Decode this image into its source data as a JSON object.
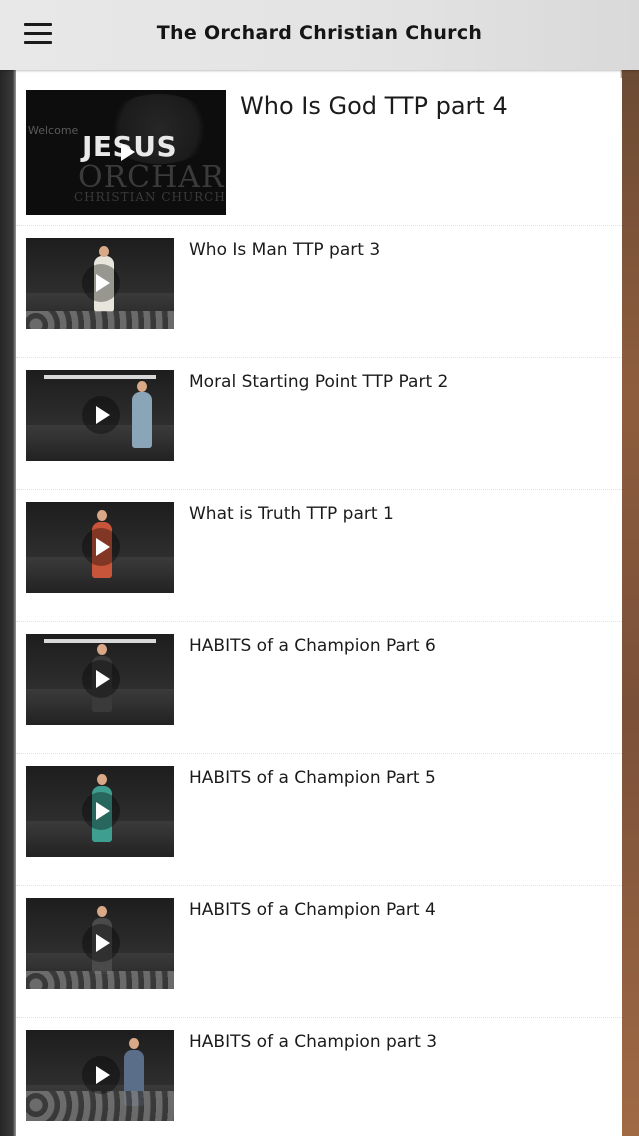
{
  "header": {
    "title": "The Orchard Christian Church",
    "menu_icon": "hamburger-menu-icon"
  },
  "featured": {
    "title": "Who Is God TTP part 4",
    "thumbnail": {
      "overlay_word": "JESUS",
      "brand_word": "ORCHARD",
      "brand_sub": "CHRISTIAN CHURCH",
      "welcome": "Welcome"
    },
    "play_icon": "play-icon"
  },
  "videos": [
    {
      "title": "Who Is Man TTP part 3",
      "play_icon": "play-icon"
    },
    {
      "title": "Moral Starting Point TTP Part 2",
      "play_icon": "play-icon"
    },
    {
      "title": "What is Truth TTP part 1",
      "play_icon": "play-icon"
    },
    {
      "title": "HABITS of a Champion Part 6",
      "play_icon": "play-icon"
    },
    {
      "title": "HABITS of a Champion Part 5",
      "play_icon": "play-icon"
    },
    {
      "title": "HABITS of a Champion Part 4",
      "play_icon": "play-icon"
    },
    {
      "title": "HABITS of a Champion part 3",
      "play_icon": "play-icon"
    }
  ],
  "colors": {
    "header_bg": "#e3e3e3",
    "title_text": "#151515",
    "item_text": "#1b1b1b",
    "panel_bg": "#ffffff",
    "right_edge_wood": "#8a5a3c"
  }
}
